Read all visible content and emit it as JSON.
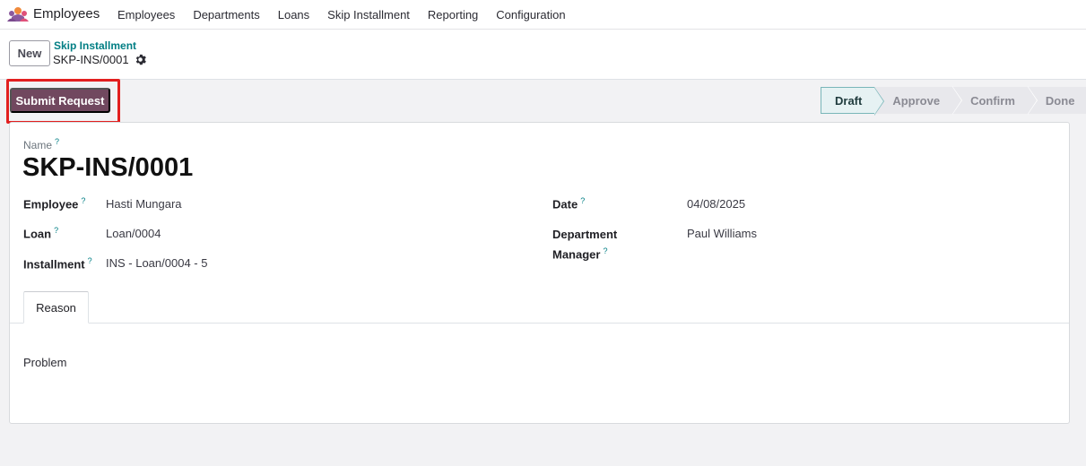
{
  "app": {
    "name": "Employees",
    "icon": "employees-app-icon"
  },
  "nav": {
    "items": [
      {
        "label": "Employees"
      },
      {
        "label": "Departments"
      },
      {
        "label": "Loans"
      },
      {
        "label": "Skip Installment"
      },
      {
        "label": "Reporting"
      },
      {
        "label": "Configuration"
      }
    ]
  },
  "control_panel": {
    "new_label": "New",
    "breadcrumb_parent": "Skip Installment",
    "record_ref": "SKP-INS/0001"
  },
  "actions": {
    "submit_label": "Submit Request"
  },
  "status": {
    "stages": [
      {
        "label": "Draft",
        "active": true
      },
      {
        "label": "Approve",
        "active": false
      },
      {
        "label": "Confirm",
        "active": false
      },
      {
        "label": "Done",
        "active": false
      }
    ]
  },
  "form": {
    "name_label": "Name",
    "help_mark": "?",
    "title": "SKP-INS/0001",
    "fields": {
      "employee_label": "Employee",
      "employee_value": "Hasti Mungara",
      "loan_label": "Loan",
      "loan_value": "Loan/0004",
      "installment_label": "Installment",
      "installment_value": "INS - Loan/0004 - 5",
      "date_label": "Date",
      "date_value": "04/08/2025",
      "dept_manager_label_1": "Department",
      "dept_manager_label_2": "Manager",
      "dept_manager_value": "Paul Williams"
    },
    "tabs": [
      {
        "label": "Reason"
      }
    ],
    "reason_text": "Problem"
  },
  "colors": {
    "brand_primary": "#71485f",
    "link_teal": "#017e84",
    "highlight_red": "#e21f1f"
  }
}
